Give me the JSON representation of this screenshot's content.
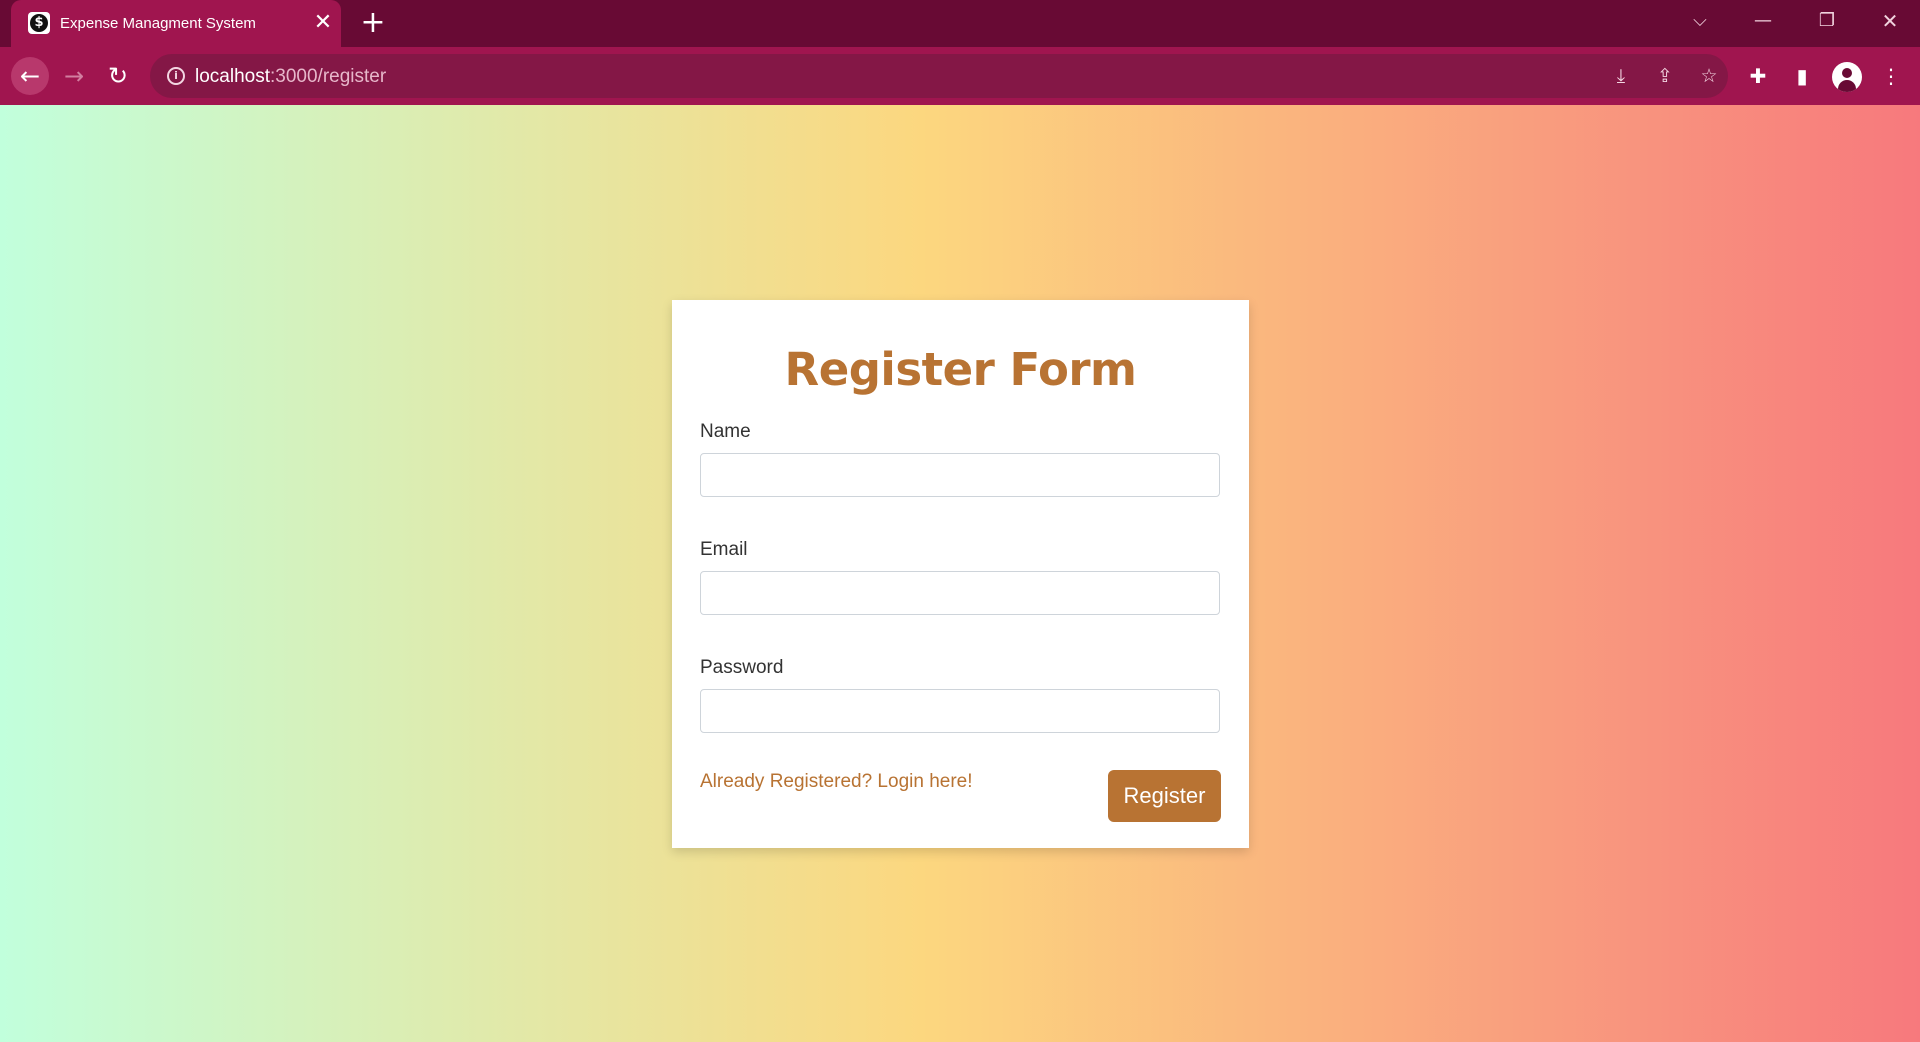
{
  "browser": {
    "tab_title": "Expense Managment System",
    "favicon_glyph": "$",
    "url_host": "localhost",
    "url_path": ":3000/register",
    "icons": {
      "tab_close": "close-icon",
      "new_tab": "plus-icon",
      "back": "arrow-left-icon",
      "forward": "arrow-right-icon",
      "reload": "reload-icon",
      "site_info": "info-icon",
      "install": "install-icon",
      "share": "share-icon",
      "bookmark": "star-icon",
      "extensions": "puzzle-icon",
      "side_panel": "side-panel-icon",
      "profile": "avatar-icon",
      "menu": "kebab-menu-icon",
      "tab_search": "chevron-down-icon",
      "minimize": "minimize-icon",
      "restore": "restore-icon",
      "close_window": "close-icon"
    },
    "colors": {
      "tabstrip": "#680a34",
      "toolbar": "#a0154f",
      "omnibox": "#841746"
    }
  },
  "page": {
    "title": "Register Form",
    "fields": [
      {
        "label": "Name",
        "value": "",
        "type": "text"
      },
      {
        "label": "Email",
        "value": "",
        "type": "email"
      },
      {
        "label": "Password",
        "value": "",
        "type": "password"
      }
    ],
    "login_link": "Already Registered? Login here!",
    "submit_label": "Register",
    "colors": {
      "accent": "#b87333",
      "gradient_start": "#c1ffdc",
      "gradient_mid": "#fcd77f",
      "gradient_end": "#f7797d"
    }
  }
}
